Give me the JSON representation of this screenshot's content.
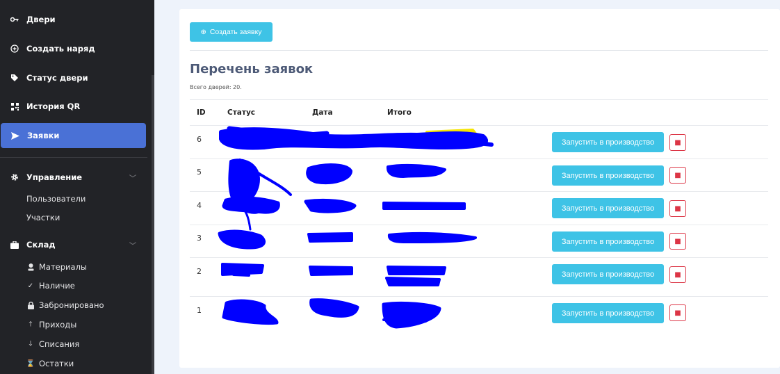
{
  "sidebar": {
    "items": [
      {
        "label": "Двери",
        "icon": "key-icon"
      },
      {
        "label": "Создать наряд",
        "icon": "plus-circle-icon"
      },
      {
        "label": "Статус двери",
        "icon": "tag-icon"
      },
      {
        "label": "История QR",
        "icon": "qr-icon"
      },
      {
        "label": "Заявки",
        "icon": "send-icon"
      }
    ],
    "management": {
      "label": "Управление",
      "items": [
        "Пользователи",
        "Участки"
      ]
    },
    "warehouse": {
      "label": "Склад",
      "items": [
        {
          "label": "Материалы",
          "icon": "person-icon"
        },
        {
          "label": "Наличие",
          "icon": "check-icon"
        },
        {
          "label": "Забронировано",
          "icon": "lock-icon"
        },
        {
          "label": "Приходы",
          "icon": "arrow-up-icon"
        },
        {
          "label": "Списания",
          "icon": "arrow-down-icon"
        },
        {
          "label": "Остатки",
          "icon": "hourglass-icon"
        }
      ]
    }
  },
  "main": {
    "create_button": "Создать заявку",
    "title": "Перечень заявок",
    "subtitle": "Всего дверей: 20.",
    "columns": [
      "ID",
      "Статус",
      "Дата",
      "Итого"
    ],
    "rows": [
      {
        "id": "6",
        "action": "Запустить в производство"
      },
      {
        "id": "5",
        "action": "Запустить в производство"
      },
      {
        "id": "4",
        "action": "Запустить в производство"
      },
      {
        "id": "3",
        "action": "Запустить в производство"
      },
      {
        "id": "2",
        "action": "Запустить в производство"
      },
      {
        "id": "1",
        "action": "Запустить в производство"
      }
    ]
  },
  "colors": {
    "sidebar_bg": "#222327",
    "active_item": "#4a71d6",
    "accent": "#3ec3e6",
    "danger": "#dc3545",
    "redaction": "#0000ff"
  }
}
